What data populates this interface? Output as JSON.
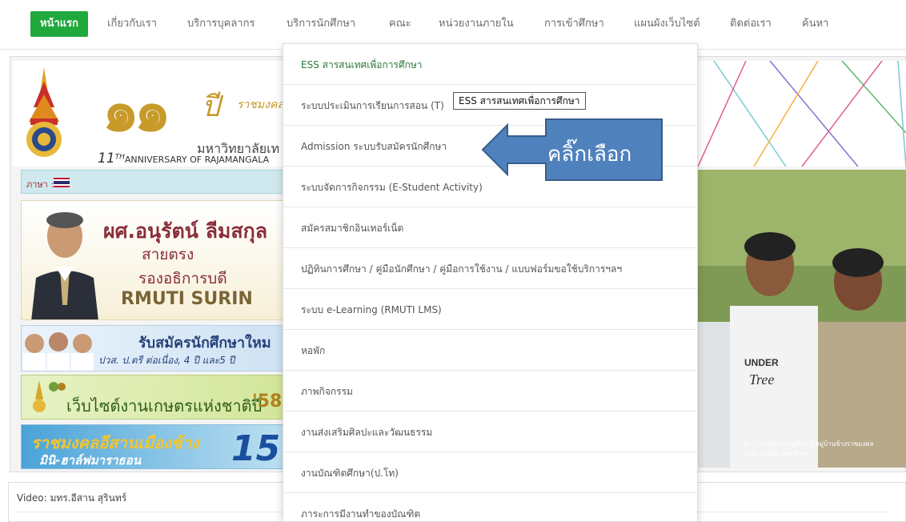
{
  "nav": {
    "items": [
      "หน้าแรก",
      "เกี่ยวกับเรา",
      "บริการบุคลากร",
      "บริการนักศึกษา",
      "คณะ",
      "หน่วยงานภายใน",
      "การเข้าศึกษา",
      "แผนผังเว็บไซต์",
      "ติดต่อเรา",
      "ค้นหา"
    ],
    "active_color": "#1fa83c"
  },
  "banner": {
    "anniversary_number": "๑๑",
    "anniversary_pi": "ปี",
    "anniversary_institution": "ราชมงคล",
    "university_name": "มหาวิทยาลัยเท",
    "anniversary_number_en": "11",
    "anniversary_suffix": "TH",
    "anniversary_en": "ANNIVERSARY OF RAJAMANGALA"
  },
  "language": {
    "label": "ภาษา :",
    "flag_icon": "thai-flag-icon"
  },
  "vp_banner": {
    "name": "ผศ.อนุรัตน์ ลีมสกุล",
    "line1": "สายตรง",
    "line2": "รองอธิการบดี",
    "line3": "RMUTI SURIN"
  },
  "admission_banner": {
    "title": "รับสมัครนักศึกษาใหม",
    "subtitle": "ปวส. ป.ตรี ต่อเนื่อง, 4 ปี และ5 ปี"
  },
  "agri_banner": {
    "text": "เว็บไซต์งานเกษตรแห่งชาติปี",
    "year": "'58"
  },
  "sport_banner": {
    "line1": "ราชมงคลอีสานเมืองช้าง",
    "line2": "มินิ-ฮาล์ฟมาราธอน",
    "number": "15"
  },
  "photo": {
    "caption_line1": "ข่าว : งานช้างทางเลือก ฯ หมู่บ้านช้างราชมงคล",
    "caption_line2": "ภาพ : under the free",
    "shirt_text1": "UNDER",
    "shirt_text2": "Tree"
  },
  "video": {
    "label": "Video: มทร.อีสาน สุรินทร์"
  },
  "dropdown": {
    "items": [
      "ESS สารสนเทศเพื่อการศึกษา",
      "ระบบประเมินการเรียนการสอน (T)",
      "Admission ระบบรับสมัครนักศึกษา",
      "ระบบจัดการกิจกรรม (E-Student Activity)",
      "สมัครสมาชิกอินเทอร์เน็ต",
      "ปฏิทินการศึกษา / คู่มือนักศึกษา / คู่มือการใช้งาน / แบบฟอร์มขอใช้บริการฯลฯ",
      "ระบบ e-Learning (RMUTI LMS)",
      "หอพัก",
      "ภาพกิจกรรม",
      "งานส่งเสริมศิลปะและวัฒนธรรม",
      "งานบัณฑิตศึกษา(ป.โท)",
      "ภาระการมีงานทำของบัณฑิต"
    ]
  },
  "tooltip": {
    "text": "ESS สารสนเทศเพื่อการศึกษา"
  },
  "callout": {
    "text": "คลิ๊กเลือก",
    "color": "#4f81bd"
  }
}
